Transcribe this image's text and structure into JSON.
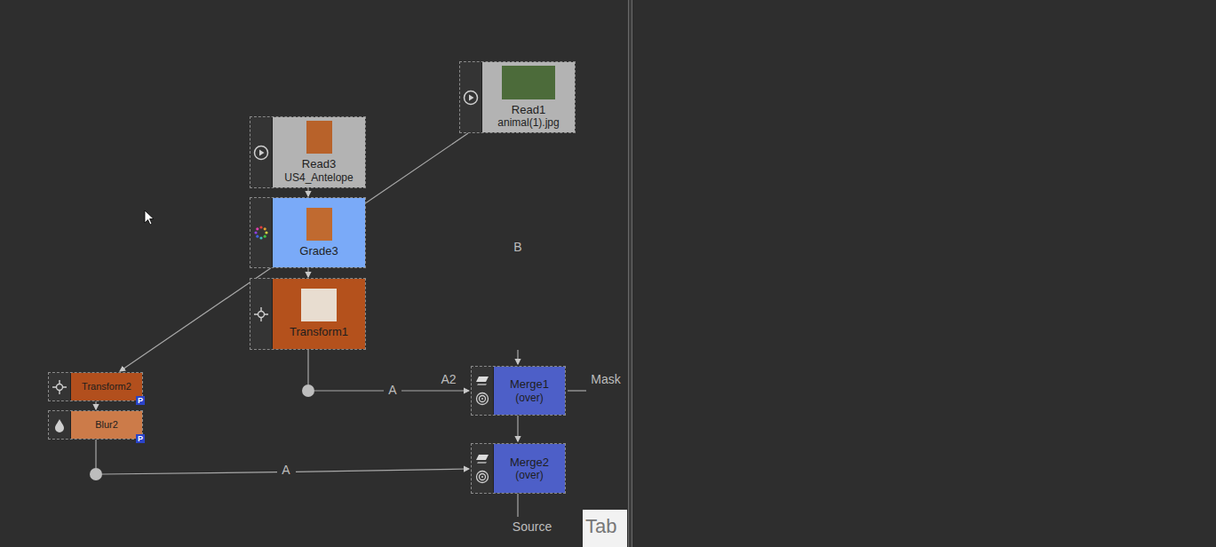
{
  "nodes": [
    {
      "label": "Read1",
      "sub": "animal(1).jpg",
      "kind": "read",
      "color": "#b3b3b3"
    },
    {
      "label": "Read3",
      "sub": "US4_Antelope",
      "kind": "read",
      "color": "#b3b3b3"
    },
    {
      "label": "Grade3",
      "sub": "",
      "kind": "grade",
      "color": "#7aaaf8"
    },
    {
      "label": "Transform1",
      "sub": "",
      "kind": "transform",
      "color": "#b4511c"
    },
    {
      "label": "Transform2",
      "sub": "",
      "kind": "transform",
      "color": "#b24f1d",
      "badge": "P"
    },
    {
      "label": "Blur2",
      "sub": "",
      "kind": "blur",
      "color": "#cc7b49",
      "badge": "P"
    },
    {
      "label": "Merge1",
      "sub": "(over)",
      "kind": "merge",
      "color": "#4d5fc8"
    },
    {
      "label": "Merge2",
      "sub": "(over)",
      "kind": "merge",
      "color": "#4d5fc8"
    }
  ],
  "input_labels": [
    {
      "label": "B"
    },
    {
      "label": "A2"
    },
    {
      "label": "A"
    },
    {
      "label": "Mask"
    },
    {
      "label": "A"
    },
    {
      "label": "Source"
    }
  ],
  "tab": {
    "label": "Tab"
  }
}
